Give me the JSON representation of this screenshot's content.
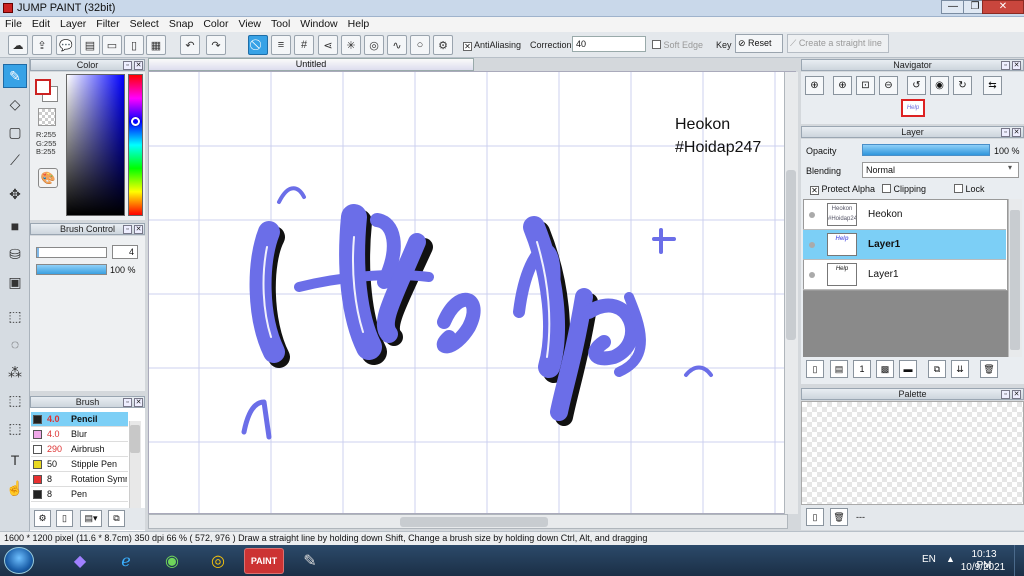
{
  "window": {
    "title": "JUMP PAINT (32bit)"
  },
  "menu": [
    "File",
    "Edit",
    "Layer",
    "Filter",
    "Select",
    "Snap",
    "Color",
    "View",
    "Tool",
    "Window",
    "Help"
  ],
  "toolbar": {
    "antialiasing_label": "AntiAliasing",
    "correction_label": "Correction",
    "correction_value": "40",
    "soft_edge_label": "Soft Edge",
    "key_label": "Key",
    "reset_label": "Reset",
    "straight_line_label": "Create a straight line"
  },
  "color_panel": {
    "title": "Color",
    "rgb": [
      "R:255",
      "G:255",
      "B:255"
    ],
    "fg_color": "#ffffff",
    "bg_color": "#ffffff"
  },
  "brush_control": {
    "title": "Brush Control",
    "size": "4",
    "opacity": "100 %"
  },
  "brush_panel": {
    "title": "Brush",
    "items": [
      {
        "size": "4.0",
        "name": "Pencil",
        "color": "#222222"
      },
      {
        "size": "4.0",
        "name": "Blur",
        "color": "#f0a8e8"
      },
      {
        "size": "290",
        "name": "Airbrush",
        "color": "#ffffff"
      },
      {
        "size": "50",
        "name": "Stipple Pen",
        "color": "#e8d820"
      },
      {
        "size": "8",
        "name": "Rotation Symmetry",
        "color": "#e83030"
      },
      {
        "size": "8",
        "name": "Pen",
        "color": "#222222"
      }
    ]
  },
  "document": {
    "tab_title": "Untitled"
  },
  "canvas": {
    "text_line1": "Heokon",
    "text_line2": "#Hoidap247",
    "lettering": "Help",
    "stroke_color": "#6b6ee8"
  },
  "navigator": {
    "title": "Navigator"
  },
  "layer_panel": {
    "title": "Layer",
    "opacity_label": "Opacity",
    "opacity_value": "100 %",
    "blending_label": "Blending",
    "blending_value": "Normal",
    "protect_alpha": "Protect Alpha",
    "clipping": "Clipping",
    "lock": "Lock",
    "layers": [
      {
        "name": "Heokon",
        "selected": false
      },
      {
        "name": "Layer1",
        "selected": true
      },
      {
        "name": "Layer1",
        "selected": false
      }
    ]
  },
  "palette_panel": {
    "title": "Palette",
    "foot_text": "---"
  },
  "status": {
    "size": "1600 * 1200 pixel",
    "cm": "(11.6 * 8.7cm)",
    "dpi": "350 dpi",
    "zoom": "66 %",
    "coords": "( 572, 976 )",
    "hint": "Draw a straight line by holding down Shift, Change a brush size by holding down Ctrl, Alt, and dragging"
  },
  "taskbar": {
    "lang": "EN",
    "time": "10:13 PM",
    "date": "10/9/2021"
  }
}
